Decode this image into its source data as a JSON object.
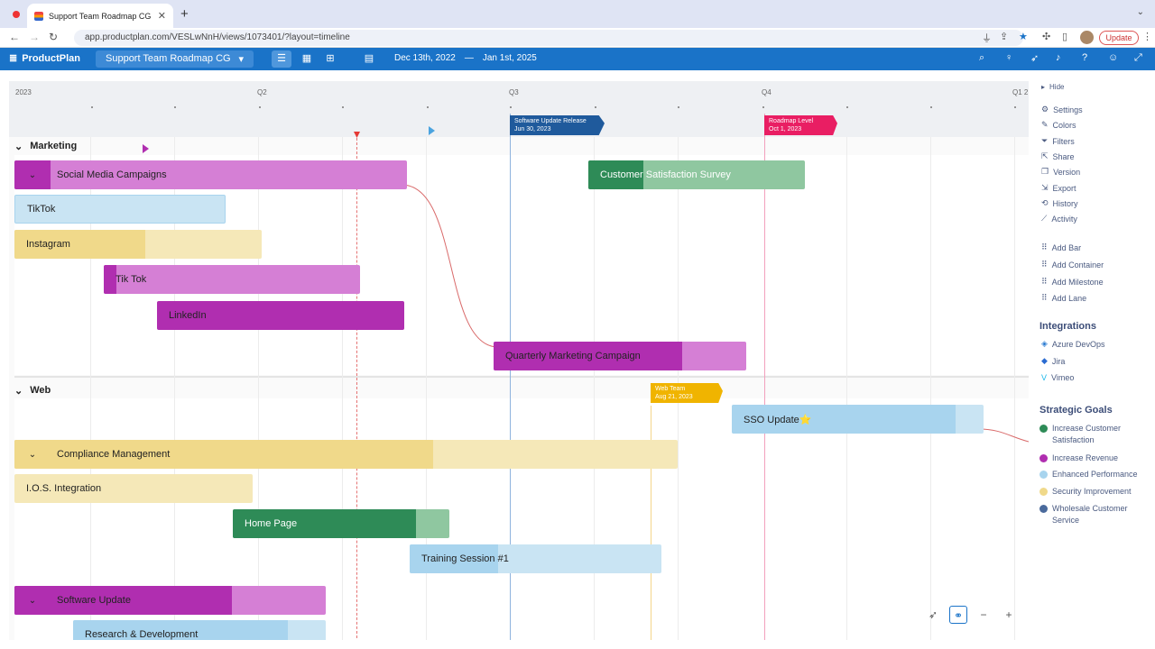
{
  "browser": {
    "tab_title": "Support Team Roadmap CG - P",
    "url": "app.productplan.com/VESLwNnH/views/1073401/?layout=timeline",
    "update_label": "Update"
  },
  "app": {
    "brand": "ProductPlan",
    "roadmap_name": "Support Team Roadmap CG",
    "date_start": "Dec 13th, 2022",
    "date_sep": "—",
    "date_end": "Jan 1st, 2025"
  },
  "timeline": {
    "quarters": [
      "2023",
      "Q2",
      "Q3",
      "Q4",
      "Q1 2"
    ]
  },
  "milestones": [
    {
      "title": "Software Update Release",
      "date": "Jun 30, 2023",
      "color": "#1f5a9c"
    },
    {
      "title": "Roadmap Level",
      "date": "Oct 1, 2023",
      "color": "#e91e63"
    },
    {
      "title": "Web Team",
      "date": "Aug 21, 2023",
      "color": "#f0b400"
    }
  ],
  "lanes": [
    {
      "name": "Marketing"
    },
    {
      "name": "Web"
    }
  ],
  "bars": {
    "social_media": "Social Media Campaigns",
    "tiktok": "TikTok",
    "instagram": "Instagram",
    "tik_tok": "Tik Tok",
    "linkedin": "LinkedIn",
    "quarterly": "Quarterly Marketing Campaign",
    "customer_survey": "Customer Satisfaction Survey",
    "sso": "SSO Update⭐",
    "compliance": "Compliance Management",
    "ios": "I.O.S. Integration",
    "home": "Home Page",
    "training": "Training Session #1",
    "software_update": "Software Update",
    "research": "Research & Development"
  },
  "panel": {
    "hide": "Hide",
    "menu": [
      "Settings",
      "Colors",
      "Filters",
      "Share",
      "Version",
      "Export",
      "History",
      "Activity"
    ],
    "add": [
      "Add Bar",
      "Add Container",
      "Add Milestone",
      "Add Lane"
    ],
    "integrations_heading": "Integrations",
    "integrations": [
      "Azure DevOps",
      "Jira",
      "Vimeo"
    ],
    "goals_heading": "Strategic Goals",
    "goals": [
      {
        "label": "Increase Customer Satisfaction",
        "color": "#2e8b57"
      },
      {
        "label": "Increase Revenue",
        "color": "#b02eb0"
      },
      {
        "label": "Enhanced Performance",
        "color": "#a8d4ee"
      },
      {
        "label": "Security Improvement",
        "color": "#f0d98a"
      },
      {
        "label": "Wholesale Customer Service",
        "color": "#4a6a9c"
      }
    ]
  },
  "colors": {
    "purple": "#b02eb0",
    "purple_light": "#d57fd5",
    "green": "#2e8b57",
    "green_light": "#8fc7a0",
    "blue_light": "#a8d4ee",
    "blue_lighter": "#c9e4f3",
    "yellow": "#f0d98a",
    "yellow_light": "#f5e8b8"
  }
}
